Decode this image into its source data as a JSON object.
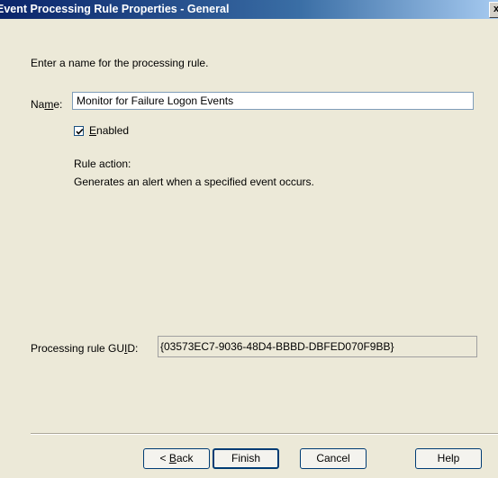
{
  "window": {
    "title": "Event Processing Rule Properties - General",
    "close_glyph": "x"
  },
  "general": {
    "instruction": "Enter a name for the processing rule.",
    "name_label_pre": "Na",
    "name_label_accel": "m",
    "name_label_post": "e:",
    "name_value": "Monitor for Failure Logon Events",
    "enabled_checked": true,
    "enabled_label_accel": "E",
    "enabled_label_rest": "nabled",
    "rule_action_label": "Rule action:",
    "rule_action_desc": "Generates an alert when a specified event occurs.",
    "guid_label_pre": "Processing rule GU",
    "guid_label_accel": "I",
    "guid_label_post": "D:",
    "guid_value": "{03573EC7-9036-48D4-BBBD-DBFED070F9BB}"
  },
  "buttons": {
    "back_pre": "< ",
    "back_accel": "B",
    "back_post": "ack",
    "finish": "Finish",
    "cancel": "Cancel",
    "help": "Help"
  }
}
